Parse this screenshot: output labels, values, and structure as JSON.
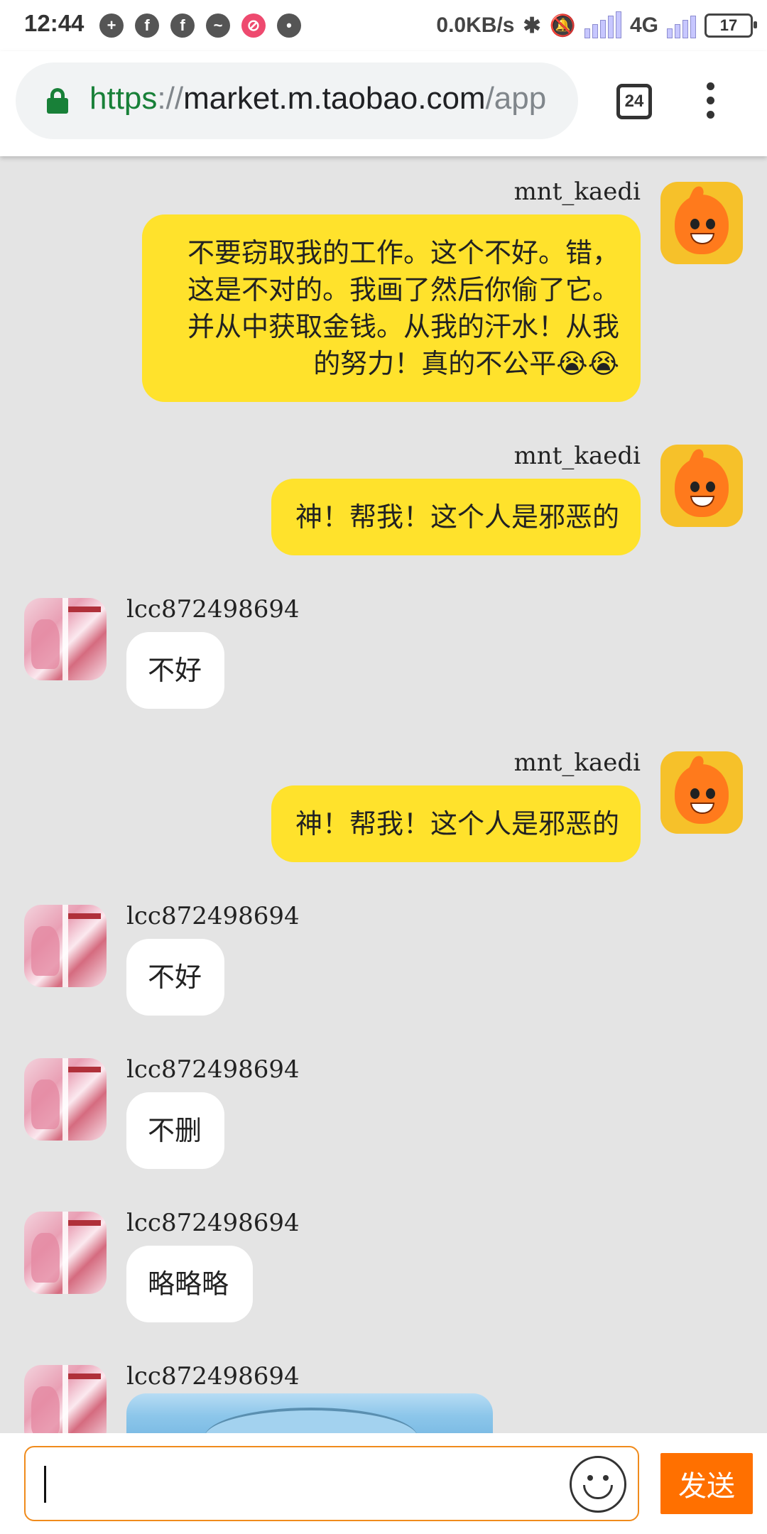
{
  "status_bar": {
    "time": "12:44",
    "net_speed": "0.0KB/s",
    "network": "4G",
    "battery": "17",
    "notif_icons": [
      "person-add-icon",
      "facebook-icon",
      "facebook-icon",
      "messenger-icon",
      "blocked-app-icon",
      "bug-icon"
    ]
  },
  "browser": {
    "url_scheme": "https",
    "url_sep": "://",
    "url_host": "market.m.taobao.com",
    "url_rest": "/app",
    "tab_count": "24"
  },
  "chat": {
    "messages": [
      {
        "sender": "mnt_kaedi",
        "side": "right",
        "lines": [
          "不要窃取我的工作。这个不好。错，",
          "这是不对的。我画了然后你偷了它。",
          "并从中获取金钱。从我的汗水！从我",
          "的努力！真的不公平😭😭"
        ]
      },
      {
        "sender": "mnt_kaedi",
        "side": "right",
        "text": "神！帮我！这个人是邪恶的"
      },
      {
        "sender": "lcc872498694",
        "side": "left",
        "text": "不好"
      },
      {
        "sender": "mnt_kaedi",
        "side": "right",
        "text": "神！帮我！这个人是邪恶的"
      },
      {
        "sender": "lcc872498694",
        "side": "left",
        "text": "不好"
      },
      {
        "sender": "lcc872498694",
        "side": "left",
        "text": "不删"
      },
      {
        "sender": "lcc872498694",
        "side": "left",
        "text": "略略略"
      },
      {
        "sender": "lcc872498694",
        "side": "left",
        "image": true
      }
    ]
  },
  "input": {
    "value": "",
    "send_label": "发送"
  },
  "colors": {
    "my_bubble": "#ffe22c",
    "their_bubble": "#ffffff",
    "send_button": "#ff7000",
    "chat_background": "#e4e4e4"
  }
}
